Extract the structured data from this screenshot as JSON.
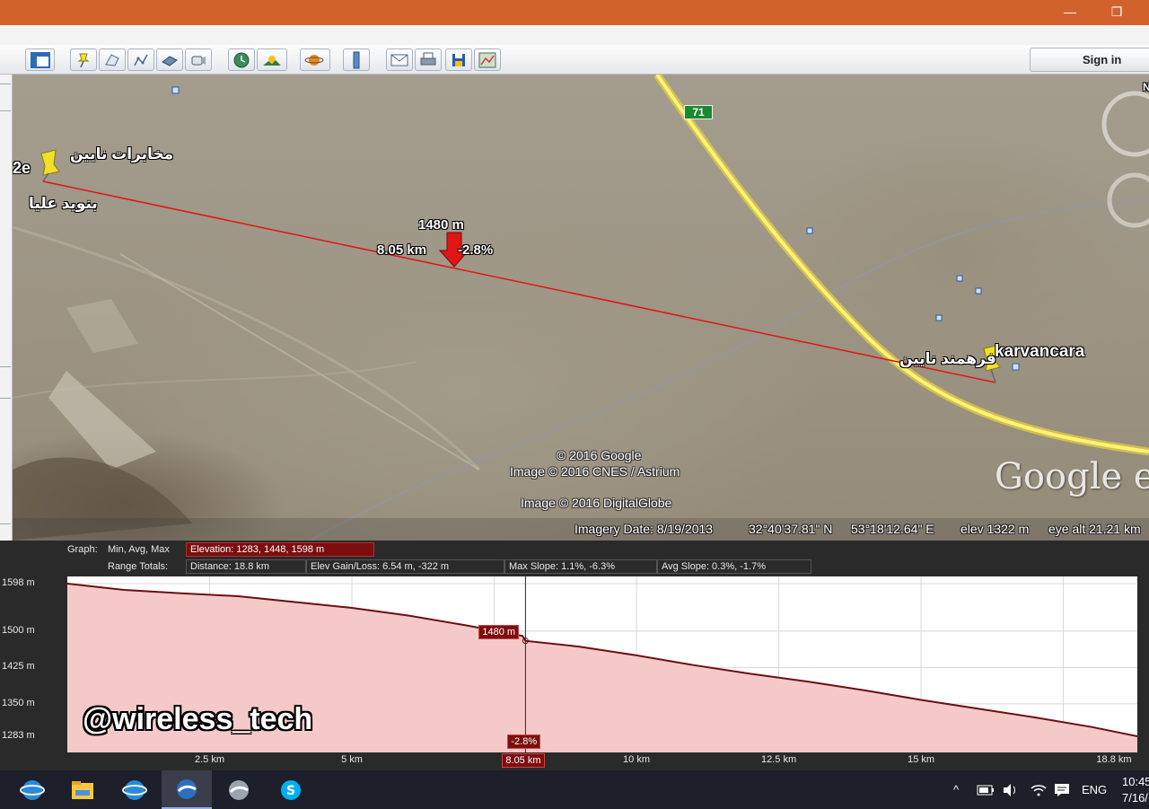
{
  "window": {
    "minimize_glyph": "—",
    "restore_glyph": "❐"
  },
  "toolbar": {
    "sign_in_label": "Sign in",
    "icons": [
      "sidebar-toggle-icon",
      "placemark-icon",
      "polygon-icon",
      "path-icon",
      "image-overlay-icon",
      "record-tour-icon",
      "historical-imagery-icon",
      "sunlight-icon",
      "planets-icon",
      "ruler-icon",
      "email-icon",
      "print-icon",
      "save-image-icon",
      "view-in-maps-icon"
    ]
  },
  "map": {
    "placemarks": {
      "left_name": "مخابرات نایین",
      "left_sub": "بنوید علیا",
      "left_cut": "2e",
      "right_name": "karvancara",
      "right_sub": "فرهمند نایین"
    },
    "road_shield": "71",
    "cursor": {
      "elevation": "1480 m",
      "distance": "8.05 km",
      "slope": "-2.8%"
    },
    "credits": {
      "line1": "© 2016 Google",
      "line2": "Image © 2016 CNES / Astrium",
      "line3": "Image © 2016 DigitalGlobe"
    },
    "logo": "Google earth",
    "north_label": "N",
    "status": {
      "imagery_date": "Imagery Date: 8/19/2013",
      "lat": "32°40'37.81\" N",
      "lon": "53°18'12.64\" E",
      "elev": "elev  1322 m",
      "eye_alt": "eye alt  21.21 km"
    }
  },
  "profile": {
    "graph_label": "Graph:",
    "graph_modes": "Min, Avg, Max",
    "elevation_stats": "Elevation: 1283, 1448, 1598 m",
    "range_label": "Range Totals:",
    "distance": "Distance: 18.8 km",
    "elev_gain_loss": "Elev Gain/Loss: 6.54 m, -322 m",
    "max_slope": "Max Slope: 1.1%, -6.3%",
    "avg_slope": "Avg Slope: 0.3%, -1.7%",
    "cursor_elev": "1480 m",
    "cursor_slope": "-2.8%",
    "cursor_dist": "8.05 km",
    "y_ticks": [
      "1598 m",
      "1500 m",
      "1425 m",
      "1350 m",
      "1283 m"
    ],
    "x_ticks": [
      "2.5 km",
      "5 km",
      "10 km",
      "12.5 km",
      "15 km",
      "18.8 km"
    ],
    "watermark": "@wireless_tech"
  },
  "chart_data": {
    "type": "area",
    "title": "",
    "xlabel": "",
    "ylabel": "",
    "x": [
      0,
      1,
      2,
      3,
      4,
      5,
      6,
      7,
      8,
      8.05,
      9,
      10,
      11,
      12,
      13,
      14,
      15,
      16,
      17,
      18,
      18.8
    ],
    "series": [
      {
        "values": [
          1598,
          1585,
          1578,
          1572,
          1560,
          1548,
          1532,
          1512,
          1490,
          1480,
          1468,
          1450,
          1430,
          1412,
          1396,
          1378,
          1358,
          1340,
          1322,
          1302,
          1283
        ]
      }
    ],
    "xlim": [
      0,
      18.8
    ],
    "ylim": [
      1283,
      1598
    ],
    "grid": true,
    "fill_color": "#f6c9c9",
    "line_color": "#6b0f0f"
  },
  "taskbar": {
    "apps": [
      "internet-explorer-icon",
      "file-explorer-icon",
      "internet-explorer-2-icon",
      "google-earth-icon",
      "globe-app-icon",
      "skype-icon"
    ],
    "tray_chevron": "^",
    "language": "ENG",
    "time": "10:45",
    "date": "7/16/"
  },
  "colors": {
    "titlebar": "#d2622b",
    "profile_bg": "#2a2a2a",
    "accent_red": "#7c0e0e",
    "path_line": "#e01515"
  }
}
